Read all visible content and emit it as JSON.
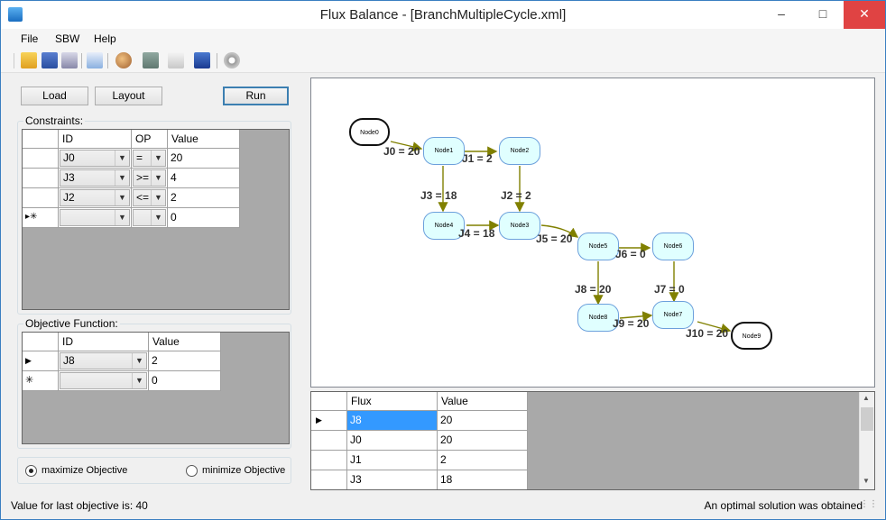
{
  "window": {
    "title": "Flux Balance - [BranchMultipleCycle.xml]"
  },
  "title_buttons": {
    "minimize": "–",
    "maximize": "□",
    "close": "✕"
  },
  "menu": {
    "file": "File",
    "sbw": "SBW",
    "help": "Help"
  },
  "toolbar": {
    "icons": [
      "open-icon",
      "save-icon",
      "print-icon",
      "copy-icon",
      "palette-icon",
      "layout-icon",
      "chart-icon",
      "info-icon",
      "gear-icon"
    ]
  },
  "buttons": {
    "load": "Load",
    "layout": "Layout",
    "run": "Run"
  },
  "constraints": {
    "legend": "Constraints:",
    "headers": {
      "id": "ID",
      "op": "OP",
      "value": "Value"
    },
    "rows": [
      {
        "id": "J0",
        "op": "=",
        "value": "20"
      },
      {
        "id": "J3",
        "op": ">=",
        "value": "4"
      },
      {
        "id": "J2",
        "op": "<=",
        "value": "2"
      },
      {
        "id": "",
        "op": "",
        "value": "0",
        "marker": "▸✳"
      }
    ]
  },
  "objective": {
    "legend": "Objective Function:",
    "headers": {
      "id": "ID",
      "value": "Value"
    },
    "rows": [
      {
        "id": "J8",
        "value": "2",
        "marker": "▶"
      },
      {
        "id": "",
        "value": "0",
        "marker": "✳"
      }
    ]
  },
  "direction": {
    "maximize": "maximize Objective",
    "minimize": "minimize Objective",
    "selected": "maximize"
  },
  "graph": {
    "nodes": {
      "n0": "Node0",
      "n1": "Node1",
      "n2": "Node2",
      "n3": "Node3",
      "n4": "Node4",
      "n5": "Node5",
      "n6": "Node6",
      "n7": "Node7",
      "n8": "Node8",
      "n9": "Node9"
    },
    "edges": {
      "j0": "J0 = 20",
      "j1": "J1 = 2",
      "j2": "J2 = 2",
      "j3": "J3 = 18",
      "j4": "J4 = 18",
      "j5": "J5 = 20",
      "j6": "J6 = 0",
      "j7": "J7 = 0",
      "j8": "J8 = 20",
      "j9": "J9 = 20",
      "j10": "J10 = 20"
    },
    "edge_color": "#808000"
  },
  "results": {
    "headers": {
      "flux": "Flux",
      "value": "Value"
    },
    "rows": [
      {
        "flux": "J8",
        "value": "20"
      },
      {
        "flux": "J0",
        "value": "20"
      },
      {
        "flux": "J1",
        "value": "2"
      },
      {
        "flux": "J3",
        "value": "18"
      }
    ]
  },
  "status": {
    "left": "Value for last objective is: 40",
    "right": "An optimal solution was obtained"
  }
}
